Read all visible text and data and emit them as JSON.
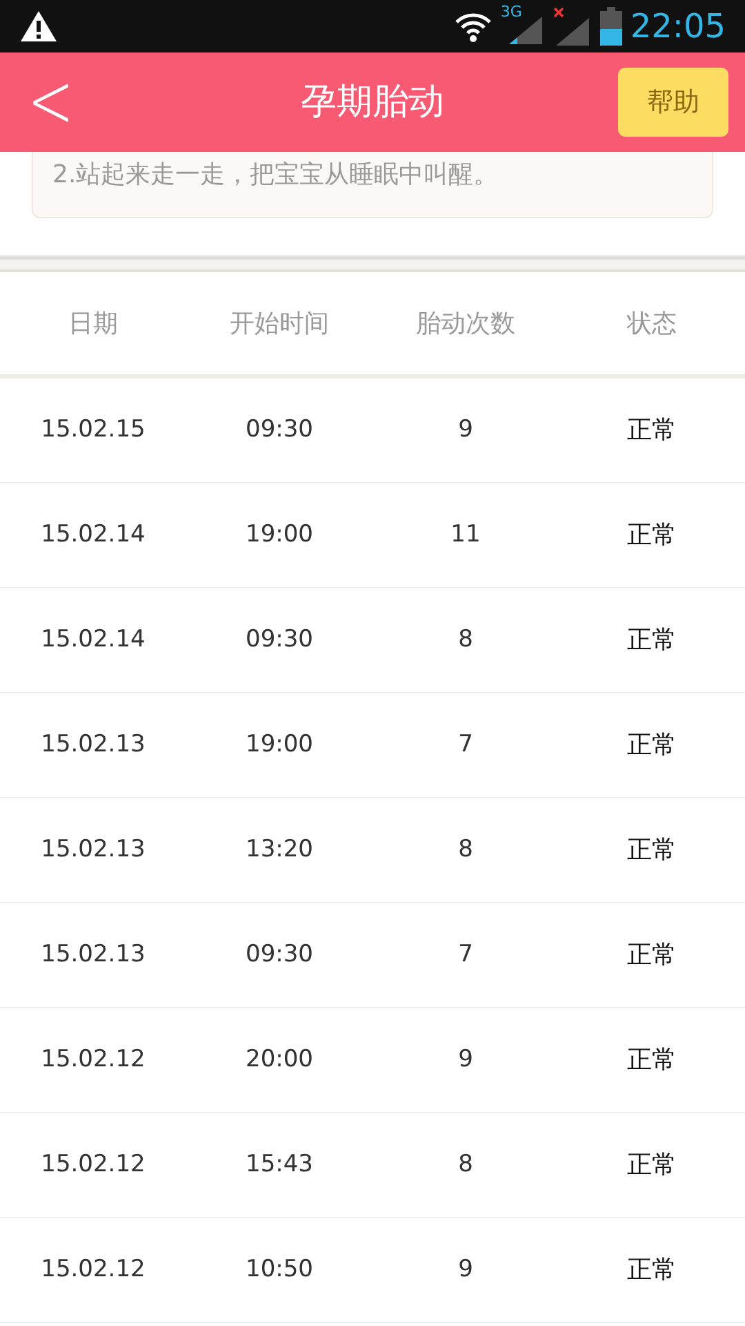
{
  "status_bar": {
    "network": "3G",
    "time": "22:05"
  },
  "header": {
    "back": "<",
    "title": "孕期胎动",
    "help_button": "帮助"
  },
  "tip": "2.站起来走一走，把宝宝从睡眠中叫醒。",
  "table": {
    "columns": [
      "日期",
      "开始时间",
      "胎动次数",
      "状态"
    ],
    "rows": [
      [
        "15.02.15",
        "09:30",
        "9",
        "正常"
      ],
      [
        "15.02.14",
        "19:00",
        "11",
        "正常"
      ],
      [
        "15.02.14",
        "09:30",
        "8",
        "正常"
      ],
      [
        "15.02.13",
        "19:00",
        "7",
        "正常"
      ],
      [
        "15.02.13",
        "13:20",
        "8",
        "正常"
      ],
      [
        "15.02.13",
        "09:30",
        "7",
        "正常"
      ],
      [
        "15.02.12",
        "20:00",
        "9",
        "正常"
      ],
      [
        "15.02.12",
        "15:43",
        "8",
        "正常"
      ],
      [
        "15.02.12",
        "10:50",
        "9",
        "正常"
      ]
    ]
  }
}
